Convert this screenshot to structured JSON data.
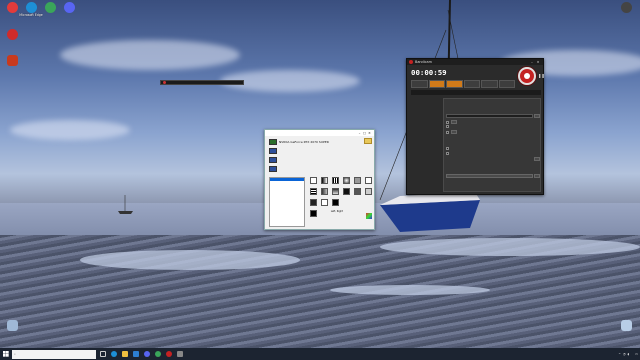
{
  "desktop_icons": [
    {
      "label": "",
      "color": "#e23b3b"
    },
    {
      "label": "Microsoft Edge",
      "color": "#1d8fd6"
    },
    {
      "label": "",
      "color": "#3aa55a"
    },
    {
      "label": "",
      "color": "#5865f2"
    },
    {
      "label": "",
      "color": "#d02b2b"
    },
    {
      "label": "",
      "color": "#c83a1e"
    },
    {
      "label": "",
      "color": "#444444"
    },
    {
      "label": "",
      "color": "#9fb8d6"
    },
    {
      "label": "",
      "color": "#b8cde6"
    }
  ],
  "overlay_bar": {
    "text": ""
  },
  "monitor_tester": {
    "title": "",
    "gpus": [
      "NVIDIA GeForce RTX 2070 SUPER",
      "",
      "",
      ""
    ],
    "resolutions": [
      "",
      "",
      "",
      "",
      "",
      "",
      "",
      "",
      "",
      "",
      "",
      "",
      "",
      ""
    ],
    "selected_resolution_index": 0,
    "stats": {
      "left_label": "Left, Right",
      "rows": [
        "",
        "",
        "",
        ""
      ],
      "right_rows": [
        "",
        "",
        "",
        ""
      ]
    }
  },
  "bandicam": {
    "title": "Bandicam",
    "timer": "00:00:59",
    "size_text": "",
    "info_text": "",
    "nav": [
      "",
      "",
      "",
      "",
      ""
    ],
    "tabs": [
      "",
      ""
    ],
    "output_label": "",
    "output_path": "",
    "buttons": {
      "browse": "",
      "open": "",
      "advanced": "",
      "hotkey_settings": "",
      "autostart": "",
      "autostop": ""
    },
    "options": [
      "",
      "",
      ""
    ],
    "section_hotkey": "",
    "section_autorec": "",
    "hotkey_options": [
      "",
      ""
    ],
    "accent": "#e9962a"
  },
  "taskbar": {
    "search_placeholder": "",
    "weather": "",
    "lang": "",
    "time": "",
    "date": ""
  }
}
